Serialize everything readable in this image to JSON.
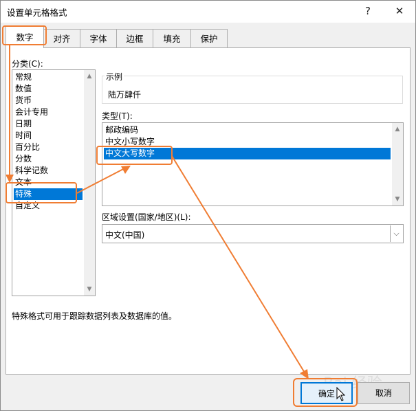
{
  "dialog": {
    "title": "设置单元格格式",
    "help_glyph": "?",
    "close_glyph": "✕"
  },
  "tabs": [
    {
      "label": "数字",
      "active": true
    },
    {
      "label": "对齐"
    },
    {
      "label": "字体"
    },
    {
      "label": "边框"
    },
    {
      "label": "填充"
    },
    {
      "label": "保护"
    }
  ],
  "category": {
    "label": "分类(C):",
    "items": [
      "常规",
      "数值",
      "货币",
      "会计专用",
      "日期",
      "时间",
      "百分比",
      "分数",
      "科学记数",
      "文本",
      "特殊",
      "自定义"
    ],
    "selected": "特殊"
  },
  "sample": {
    "label": "示例",
    "value": "陆万肆仟"
  },
  "type": {
    "label": "类型(T):",
    "items": [
      "邮政编码",
      "中文小写数字",
      "中文大写数字"
    ],
    "selected": "中文大写数字"
  },
  "locale": {
    "label": "区域设置(国家/地区)(L):",
    "value": "中文(中国)"
  },
  "description": "特殊格式可用于跟踪数据列表及数据库的值。",
  "buttons": {
    "ok": "确定",
    "cancel": "取消"
  },
  "watermark": "Bai 经验",
  "colors": {
    "selection": "#0078d7",
    "annotation": "#f07d33"
  }
}
